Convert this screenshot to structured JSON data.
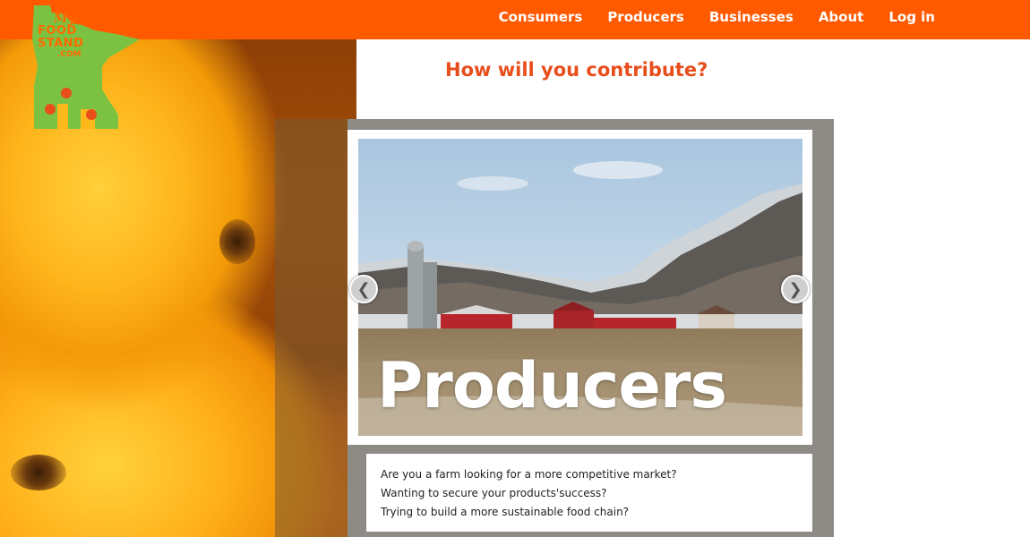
{
  "site": {
    "logo_text": {
      "my": "My",
      "food": "FOOD",
      "stand": "STAND",
      "com": ".COM"
    }
  },
  "nav": {
    "items": [
      "Consumers",
      "Producers",
      "Businesses",
      "About",
      "Log in"
    ]
  },
  "main": {
    "heading": "How will you contribute?",
    "slider": {
      "caption": "Producers",
      "prev_icon": "chevron-left-icon",
      "next_icon": "chevron-right-icon",
      "description": [
        "Are you a farm looking for a more competitive market?",
        "Wanting to secure your products'success?",
        "Trying to build a more sustainable food chain?"
      ]
    }
  },
  "colors": {
    "brand_orange": "#ff5a00",
    "heading_red": "#e84e1c",
    "logo_green": "#7cc242",
    "frame_grey": "#8e8b86"
  }
}
